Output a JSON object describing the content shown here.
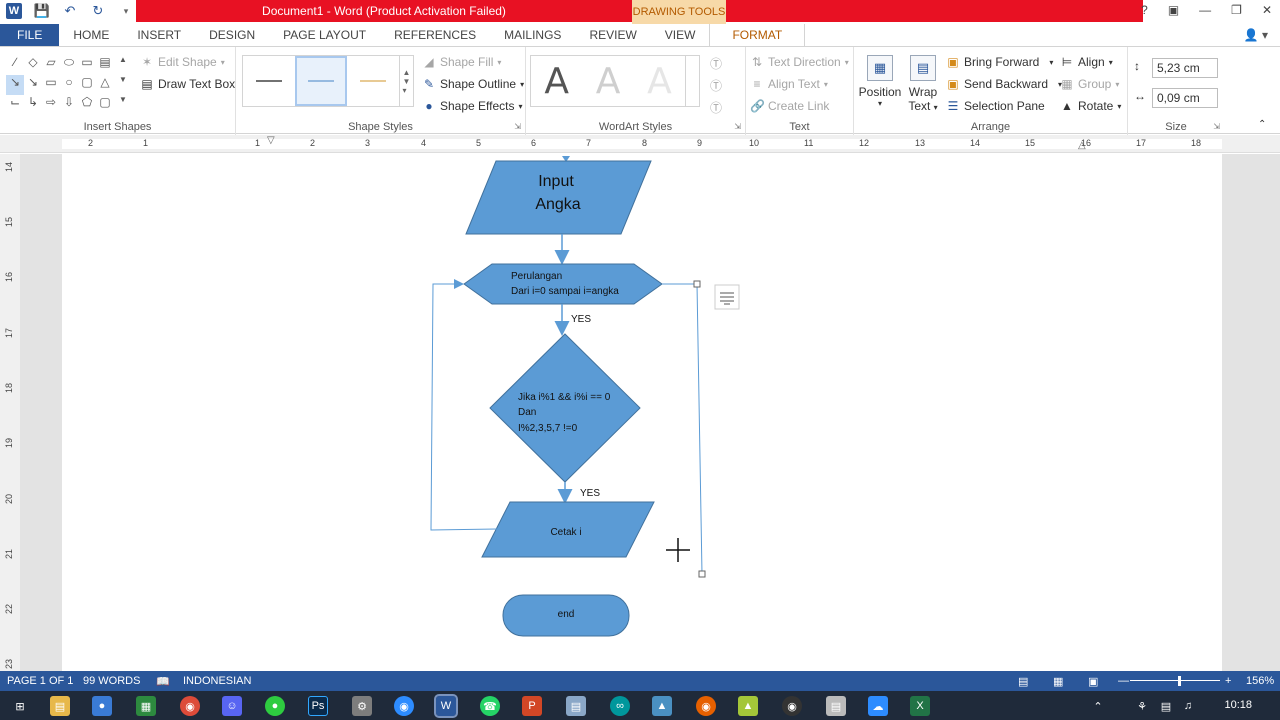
{
  "app": {
    "title": "Document1 -  Word (Product Activation Failed)",
    "context_tab_header": "DRAWING TOOLS",
    "help": "?"
  },
  "tabs": [
    "FILE",
    "HOME",
    "INSERT",
    "DESIGN",
    "PAGE LAYOUT",
    "REFERENCES",
    "MAILINGS",
    "REVIEW",
    "VIEW",
    "FORMAT"
  ],
  "ribbon": {
    "insert_shapes": {
      "label": "Insert Shapes",
      "edit_shape": "Edit Shape",
      "draw_text_box": "Draw Text Box"
    },
    "shape_styles": {
      "label": "Shape Styles",
      "fill": "Shape Fill",
      "outline": "Shape Outline",
      "effects": "Shape Effects"
    },
    "wordart": {
      "label": "WordArt Styles",
      "letter": "A"
    },
    "text": {
      "label": "Text",
      "direction": "Text Direction",
      "align": "Align Text",
      "link": "Create Link"
    },
    "arrange": {
      "label": "Arrange",
      "position": "Position",
      "wrap": "Wrap",
      "wrap2": "Text",
      "bring_forward": "Bring Forward",
      "send_backward": "Send Backward",
      "selection_pane": "Selection Pane",
      "align": "Align",
      "group": "Group",
      "rotate": "Rotate"
    },
    "size": {
      "label": "Size",
      "height": "5,23 cm",
      "width": "0,09 cm"
    }
  },
  "ruler": {
    "h": [
      "2",
      "1",
      "1",
      "2",
      "3",
      "4",
      "5",
      "6",
      "7",
      "8",
      "9",
      "10",
      "11",
      "12",
      "13",
      "14",
      "15",
      "16",
      "17",
      "18"
    ],
    "v": [
      "14",
      "15",
      "16",
      "17",
      "18",
      "19",
      "20",
      "21",
      "22",
      "23"
    ]
  },
  "flowchart": {
    "input_line1": "Input",
    "input_line2": "Angka",
    "loop_line1": "Perulangan",
    "loop_line2": "Dari i=0 sampai i=angka",
    "yes1": "YES",
    "cond_line1": "Jika i%1 && i%i == 0",
    "cond_line2": "Dan",
    "cond_line3": "I%2,3,5,7 !=0",
    "yes2": "YES",
    "output": "Cetak i",
    "end": "end"
  },
  "status": {
    "page": "PAGE 1 OF 1",
    "words": "99 WORDS",
    "language": "INDONESIAN",
    "zoom": "156%"
  },
  "taskbar": {
    "time": "10:18"
  },
  "colors": {
    "word_blue": "#2b579a",
    "shape_fill": "#5b9bd5",
    "shape_stroke": "#41719c",
    "title_red": "#e81123"
  }
}
